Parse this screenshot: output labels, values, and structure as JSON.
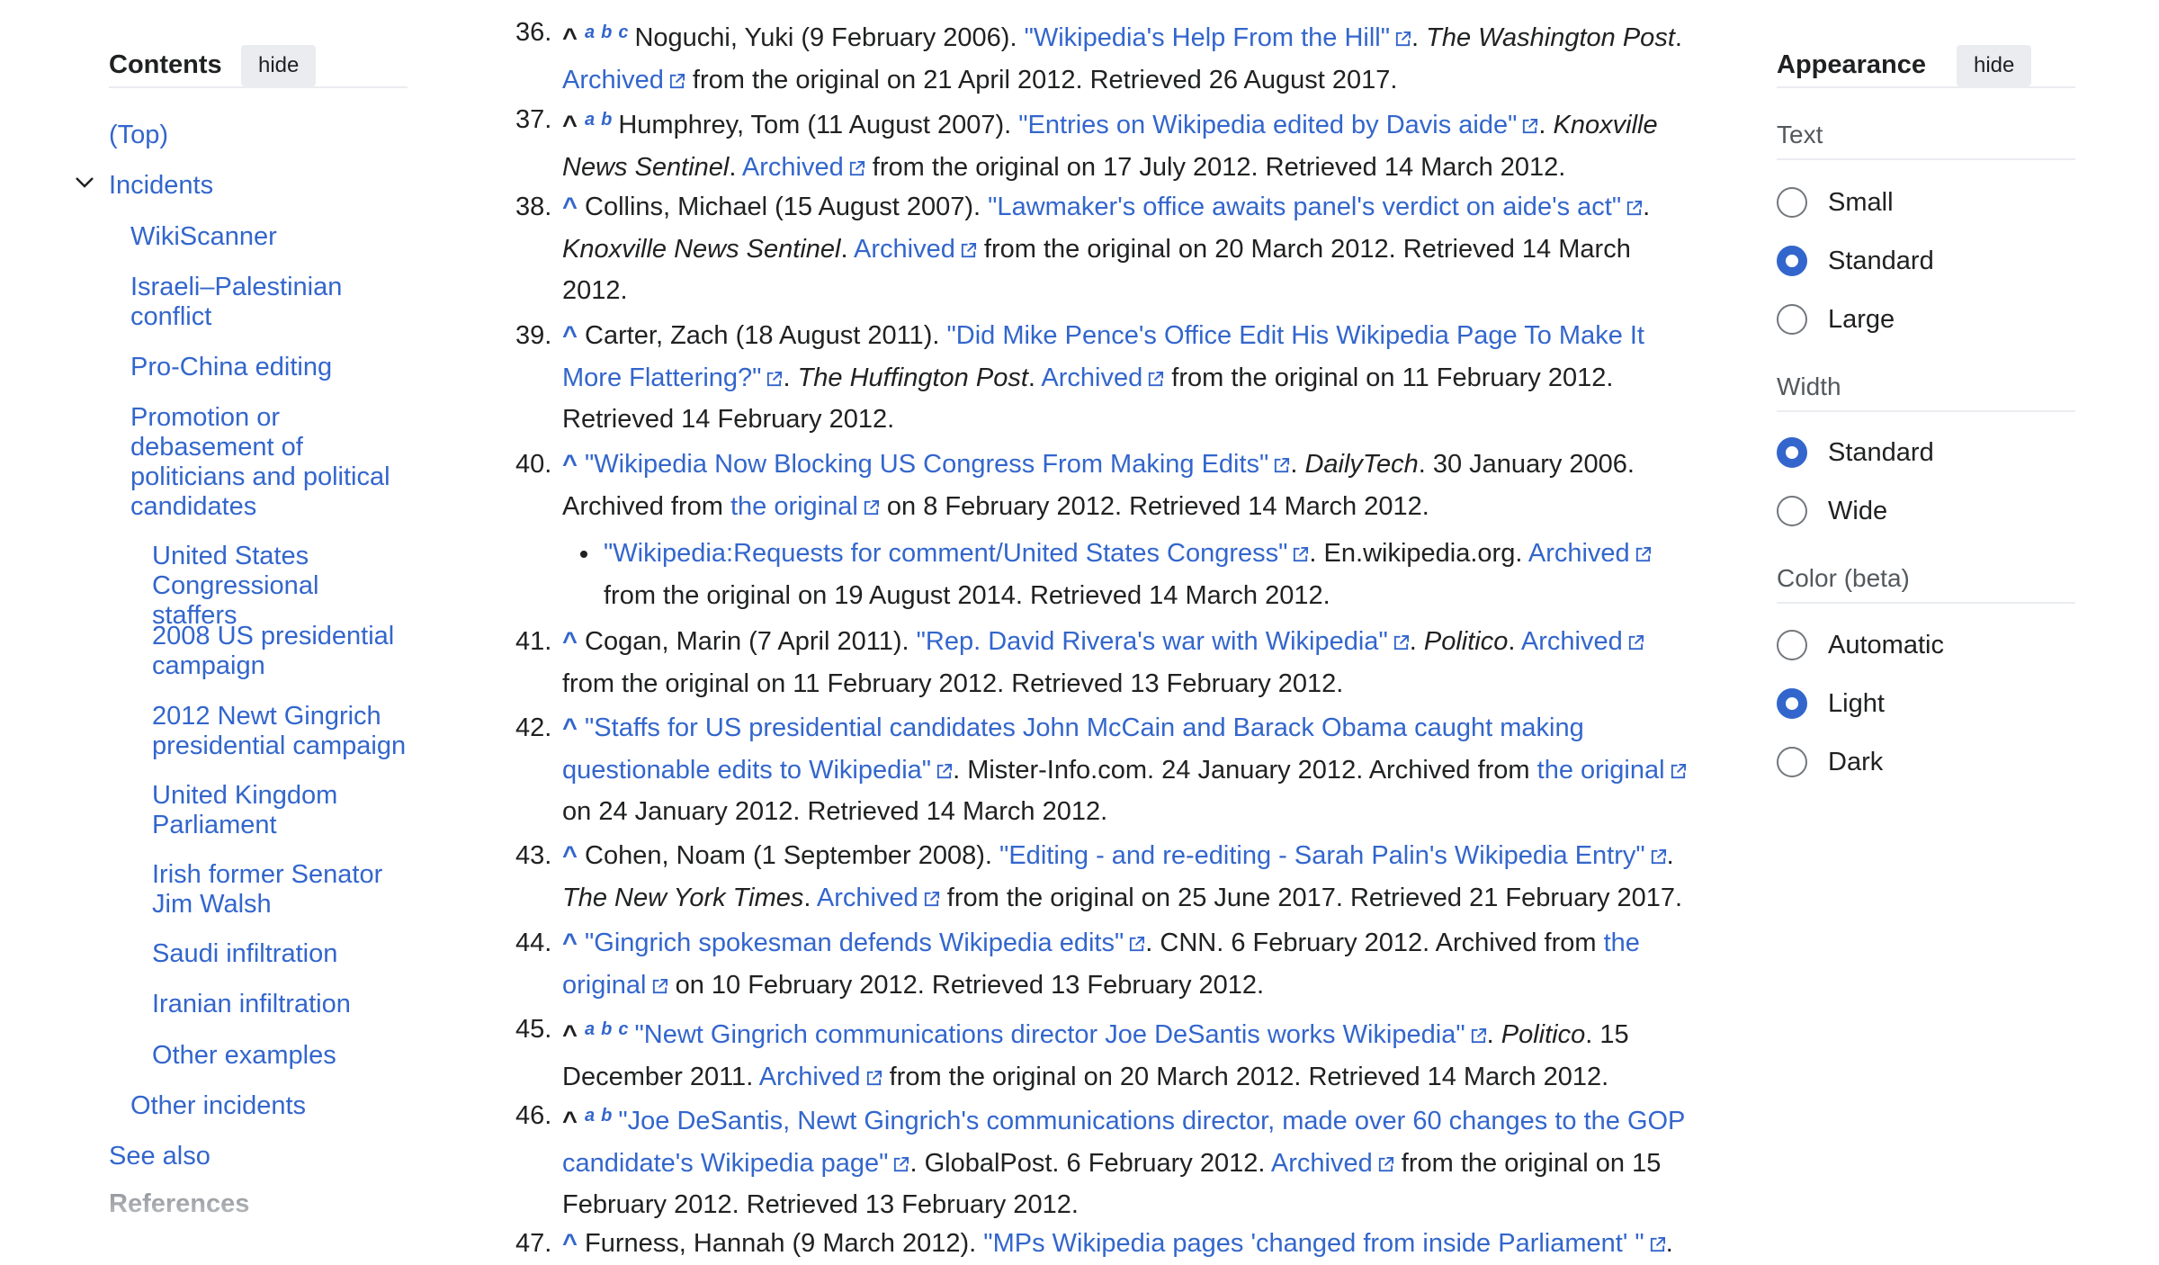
{
  "toc": {
    "title": "Contents",
    "hide_label": "hide",
    "top": "(Top)",
    "incidents": "Incidents",
    "items": [
      [
        "WikiScanner"
      ],
      [
        "Israeli–Palestinian",
        "conflict"
      ],
      [
        "Pro-China editing"
      ],
      [
        "Promotion or",
        "debasement of",
        "politicians and political",
        "candidates"
      ],
      [
        "United States",
        "Congressional staffers"
      ],
      [
        "2008 US presidential",
        "campaign"
      ],
      [
        "2012 Newt Gingrich",
        "presidential campaign"
      ],
      [
        "United Kingdom",
        "Parliament"
      ],
      [
        "Irish former Senator",
        "Jim Walsh"
      ],
      [
        "Saudi infiltration"
      ],
      [
        "Iranian infiltration"
      ],
      [
        "Other examples"
      ],
      [
        "Other incidents"
      ]
    ],
    "see_also": "See also",
    "references": "References"
  },
  "references": {
    "r36": {
      "num": "36.",
      "backlinks": [
        "a",
        "b",
        "c"
      ],
      "author": "Noguchi, Yuki (9 February 2006).",
      "title": "\"Wikipedia's Help From the Hill\"",
      "publication": "The Washington Post",
      "archived": "Archived",
      "tail": "from the original on 21 April 2012. Retrieved 26 August 2017."
    },
    "r37": {
      "num": "37.",
      "backlinks": [
        "a",
        "b"
      ],
      "author": "Humphrey, Tom (11 August 2007).",
      "title": "\"Entries on Wikipedia edited by Davis aide\"",
      "publication_1": "Knoxville",
      "publication_2": "News Sentinel",
      "archived": "Archived",
      "tail": "from the original on 17 July 2012. Retrieved 14 March 2012."
    },
    "r38": {
      "num": "38.",
      "author": "Collins, Michael (15 August 2007).",
      "title": "\"Lawmaker's office awaits panel's verdict on aide's act\"",
      "publication": "Knoxville News Sentinel",
      "archived": "Archived",
      "tail_1": "from the original on 20 March 2012. Retrieved 14 March",
      "tail_2": "2012."
    },
    "r39": {
      "num": "39.",
      "author": "Carter, Zach (18 August 2011).",
      "title_1": "\"Did Mike Pence's Office Edit His Wikipedia Page To Make It",
      "title_2": "More Flattering?\"",
      "publication": "The Huffington Post",
      "archived": "Archived",
      "tail_1": "from the original on 11 February 2012.",
      "tail_2": "Retrieved 14 February 2012."
    },
    "r40": {
      "num": "40.",
      "title": "\"Wikipedia Now Blocking US Congress From Making Edits\"",
      "publication": "DailyTech",
      "date": ". 30 January 2006.",
      "archived_from": "Archived from",
      "the_original": "the original",
      "tail": "on 8 February 2012. Retrieved 14 March 2012.",
      "sub_title": "\"Wikipedia:Requests for comment/United States Congress\"",
      "sub_pub": ". En.wikipedia.org.",
      "sub_archived": "Archived",
      "sub_tail": "from the original on 19 August 2014. Retrieved 14 March 2012."
    },
    "r41": {
      "num": "41.",
      "author": "Cogan, Marin (7 April 2011).",
      "title": "\"Rep. David Rivera's war with Wikipedia\"",
      "publication": "Politico",
      "archived": "Archived",
      "tail": "from the original on 11 February 2012. Retrieved 13 February 2012."
    },
    "r42": {
      "num": "42.",
      "title_1": "\"Staffs for US presidential candidates John McCain and Barack Obama caught making",
      "title_2": "questionable edits to Wikipedia\"",
      "mid": ". Mister-Info.com. 24 January 2012. Archived from",
      "the_original": "the original",
      "tail": "on 24 January 2012. Retrieved 14 March 2012."
    },
    "r43": {
      "num": "43.",
      "author": "Cohen, Noam (1 September 2008).",
      "title": "\"Editing - and re-editing - Sarah Palin's Wikipedia Entry\"",
      "publication": "The New York Times",
      "archived": "Archived",
      "tail": "from the original on 25 June 2017. Retrieved 21 February 2017."
    },
    "r44": {
      "num": "44.",
      "title": "\"Gingrich spokesman defends Wikipedia edits\"",
      "mid": ". CNN. 6 February 2012. Archived from",
      "the_original_1": "the",
      "the_original_2": "original",
      "tail": "on 10 February 2012. Retrieved 13 February 2012."
    },
    "r45": {
      "num": "45.",
      "backlinks": [
        "a",
        "b",
        "c"
      ],
      "title": "\"Newt Gingrich communications director Joe DeSantis works Wikipedia\"",
      "publication": "Politico",
      "date_1": ". 15",
      "date_2": "December 2011.",
      "archived": "Archived",
      "tail": "from the original on 20 March 2012. Retrieved 14 March 2012."
    },
    "r46": {
      "num": "46.",
      "backlinks": [
        "a",
        "b"
      ],
      "title_1": "\"Joe DeSantis, Newt Gingrich's communications director, made over 60 changes to the GOP",
      "title_2": "candidate's Wikipedia page\"",
      "mid": ". GlobalPost. 6 February 2012.",
      "archived": "Archived",
      "tail_1": "from the original on 15",
      "tail_2": "February 2012. Retrieved 13 February 2012."
    },
    "r47": {
      "num": "47.",
      "author": "Furness, Hannah (9 March 2012).",
      "title": "\"MPs Wikipedia pages 'changed from inside Parliament' \""
    }
  },
  "appearance": {
    "title": "Appearance",
    "hide_label": "hide",
    "text_label": "Text",
    "text_options": [
      "Small",
      "Standard",
      "Large"
    ],
    "text_selected": "Standard",
    "width_label": "Width",
    "width_options": [
      "Standard",
      "Wide"
    ],
    "width_selected": "Standard",
    "color_label": "Color (beta)",
    "color_options": [
      "Automatic",
      "Light",
      "Dark"
    ],
    "color_selected": "Light"
  },
  "colors": {
    "link": "#3366cc",
    "text": "#202122",
    "muted": "#54595d",
    "button_bg": "#eaecf0"
  }
}
